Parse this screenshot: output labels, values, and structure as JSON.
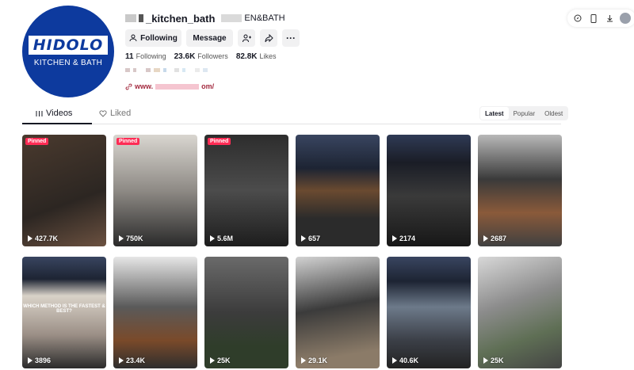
{
  "profile": {
    "logo_text": "HIDOLO",
    "logo_sub": "KITCHEN & BATH",
    "username": "_kitchen_bath",
    "nickname": "EN&BATH",
    "following_label": "Following",
    "message_label": "Message",
    "stats": {
      "following_count": "11",
      "following_label": "Following",
      "followers_count": "23.6K",
      "followers_label": "Followers",
      "likes_count": "82.8K",
      "likes_label": "Likes"
    },
    "link_prefix": "www.",
    "link_suffix": "om/"
  },
  "tabs": {
    "videos": "Videos",
    "liked": "Liked"
  },
  "sort": {
    "latest": "Latest",
    "popular": "Popular",
    "oldest": "Oldest"
  },
  "videos": [
    {
      "views": "427.7K",
      "pinned": "Pinned"
    },
    {
      "views": "750K",
      "pinned": "Pinned"
    },
    {
      "views": "5.6M",
      "pinned": "Pinned"
    },
    {
      "views": "657"
    },
    {
      "views": "2174"
    },
    {
      "views": "2687"
    },
    {
      "views": "3896",
      "overlay": "WHICH METHOD IS THE FASTEST & BEST?"
    },
    {
      "views": "23.4K"
    },
    {
      "views": "25K"
    },
    {
      "views": "29.1K"
    },
    {
      "views": "40.6K"
    },
    {
      "views": "25K"
    }
  ],
  "colors": {
    "pinned": "#fe2c55",
    "brand": "#0d3a9e",
    "link": "#a32a3f"
  }
}
